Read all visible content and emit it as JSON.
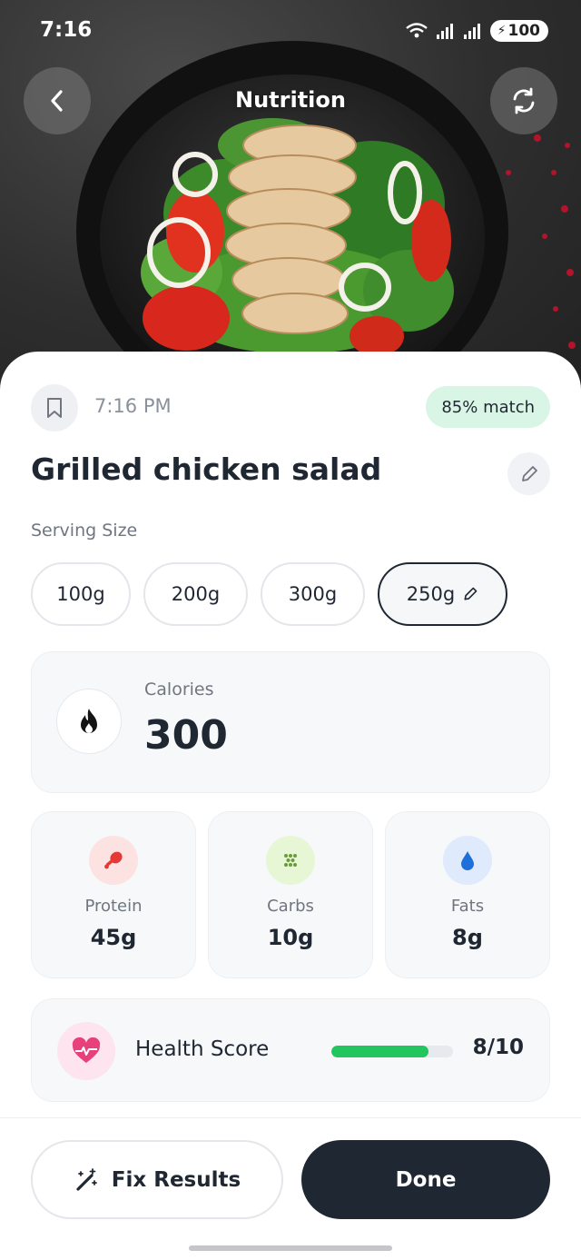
{
  "status_bar": {
    "time": "7:16",
    "battery": "100"
  },
  "header": {
    "title": "Nutrition"
  },
  "meal": {
    "time": "7:16 PM",
    "match": "85% match",
    "name": "Grilled chicken salad"
  },
  "serving": {
    "label": "Serving Size",
    "options": [
      "100g",
      "200g",
      "300g",
      "250g"
    ],
    "selected": "250g"
  },
  "calories": {
    "label": "Calories",
    "value": "300"
  },
  "macros": [
    {
      "label": "Protein",
      "value": "45g",
      "icon": "drumstick-icon",
      "color": "#e53935",
      "bg": "#fde2e2"
    },
    {
      "label": "Carbs",
      "value": "10g",
      "icon": "grain-icon",
      "color": "#6a9a3a",
      "bg": "#e7f7d6"
    },
    {
      "label": "Fats",
      "value": "8g",
      "icon": "droplet-icon",
      "color": "#1e6fd9",
      "bg": "#dfeafc"
    }
  ],
  "health": {
    "label": "Health Score",
    "value": "8/10",
    "fraction": 0.8,
    "color": "#22c55e"
  },
  "actions": {
    "fix": "Fix Results",
    "done": "Done"
  },
  "colors": {
    "dark": "#1f2733",
    "match_bg": "#d9f5e5",
    "heart": "#e8407a"
  }
}
